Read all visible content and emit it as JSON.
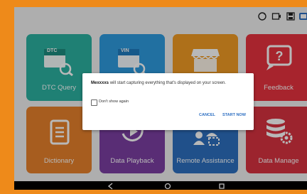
{
  "tiles": [
    {
      "label": "DTC Query",
      "badge": "DTC",
      "icon": "dtc-search-icon",
      "color": "#2bb2a1"
    },
    {
      "label": "",
      "badge": "VIN",
      "icon": "vin-search-icon",
      "color": "#2f9be0"
    },
    {
      "label": "",
      "badge": "",
      "icon": "store-icon",
      "color": "#f29b24"
    },
    {
      "label": "Feedback",
      "badge": "",
      "icon": "feedback-question-icon",
      "color": "#e8333f"
    },
    {
      "label": "Dictionary",
      "badge": "",
      "icon": "dictionary-icon",
      "color": "#e8822b"
    },
    {
      "label": "Data Playback",
      "badge": "",
      "icon": "playback-icon",
      "color": "#7c3fa2"
    },
    {
      "label": "Remote Assistance",
      "badge": "",
      "icon": "remote-assistance-icon",
      "color": "#2d70bf"
    },
    {
      "label": "Data Manage",
      "badge": "",
      "icon": "database-gear-icon",
      "color": "#d83340"
    }
  ],
  "dialog": {
    "app_name": "Mexxxxs",
    "message": " will start capturing everything that's displayed on your screen.",
    "checkbox_label": "Don't show again",
    "cancel_label": "CANCEL",
    "start_label": "START NOW"
  },
  "status_icons": [
    "sync-icon",
    "screen-record-icon",
    "save-icon",
    "screenshot-icon"
  ]
}
